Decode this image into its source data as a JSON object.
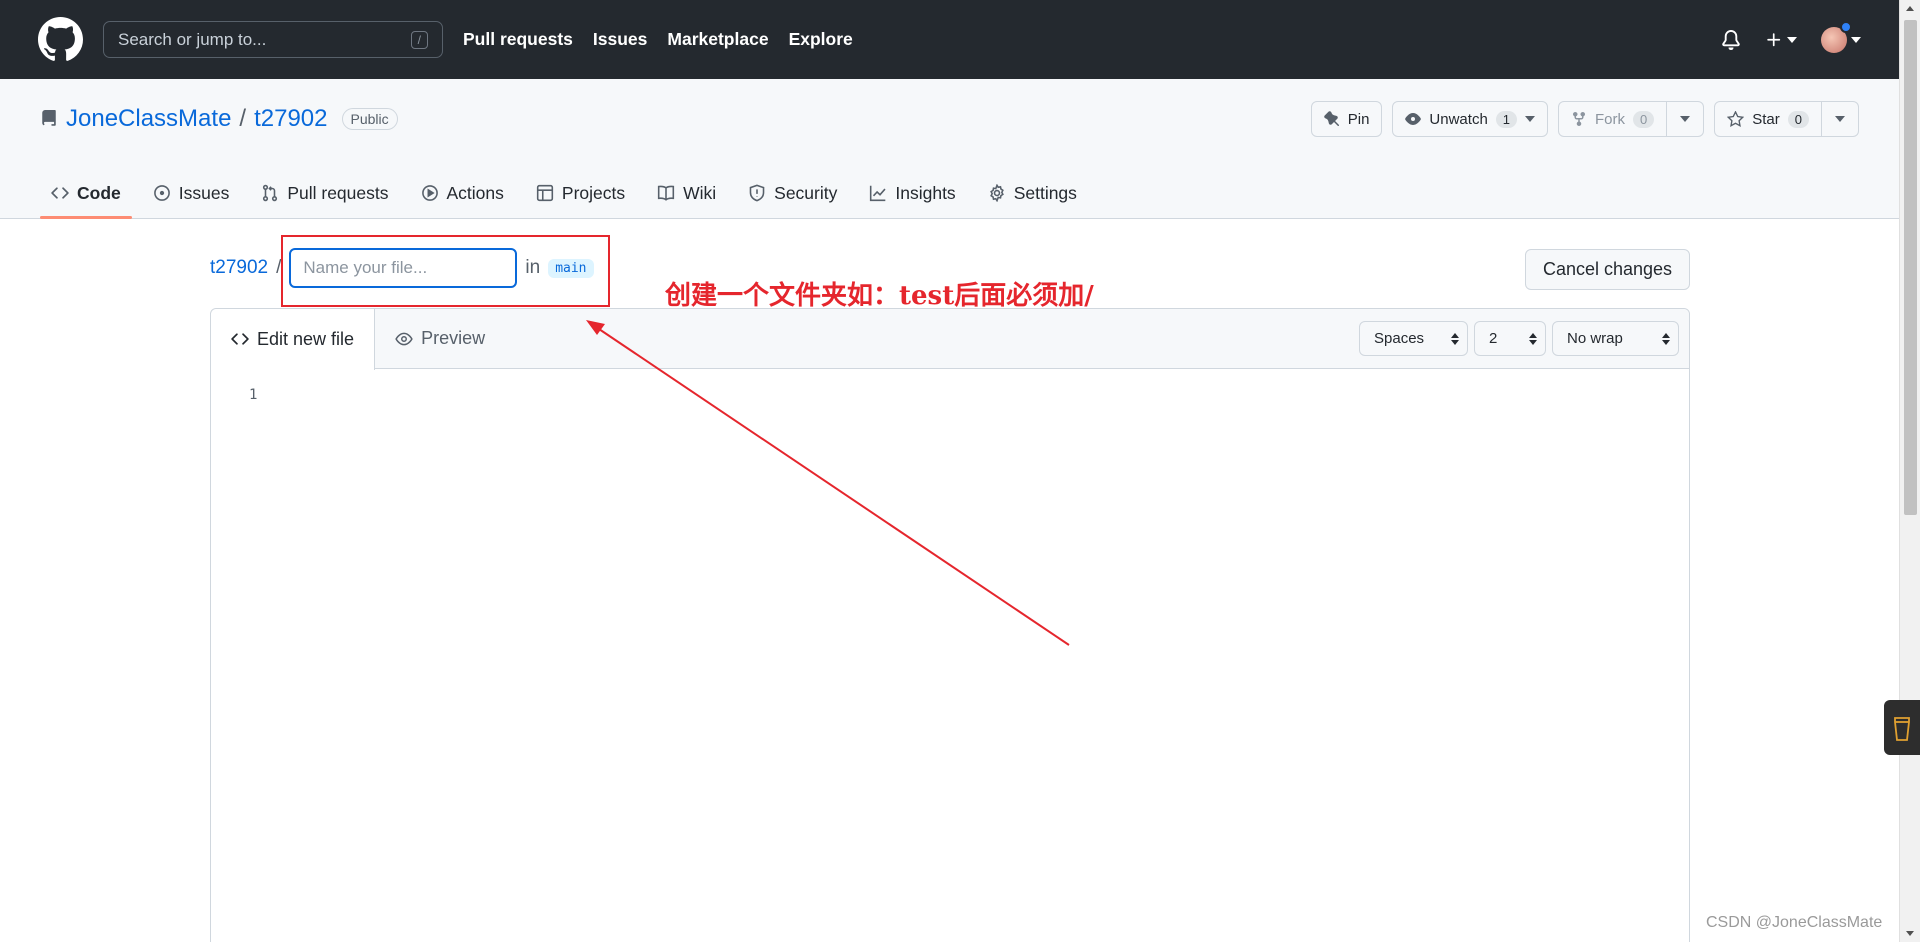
{
  "header": {
    "search_placeholder": "Search or jump to...",
    "search_key": "/",
    "nav": [
      "Pull requests",
      "Issues",
      "Marketplace",
      "Explore"
    ]
  },
  "repo": {
    "owner": "JoneClassMate",
    "separator": "/",
    "name": "t27902",
    "visibility": "Public",
    "actions": {
      "pin": "Pin",
      "watch": "Unwatch",
      "watch_count": "1",
      "fork": "Fork",
      "fork_count": "0",
      "star": "Star",
      "star_count": "0"
    },
    "tabs": [
      "Code",
      "Issues",
      "Pull requests",
      "Actions",
      "Projects",
      "Wiki",
      "Security",
      "Insights",
      "Settings"
    ]
  },
  "editor": {
    "breadcrumb_repo": "t27902",
    "breadcrumb_sep": "/",
    "filename_placeholder": "Name your file...",
    "filename_value": "",
    "in_label": "in",
    "branch": "main",
    "cancel": "Cancel changes",
    "tab_edit": "Edit new file",
    "tab_preview": "Preview",
    "indent_mode": "Spaces",
    "indent_size": "2",
    "wrap_mode": "No wrap",
    "line_number": "1"
  },
  "annotation": {
    "text": "创建一个文件夹如：test后面必须加/",
    "color": "#e5262d"
  },
  "watermark": "CSDN @JoneClassMate",
  "colors": {
    "header_bg": "#24292f",
    "link": "#0969da",
    "active_tab_underline": "#fd8c73"
  }
}
